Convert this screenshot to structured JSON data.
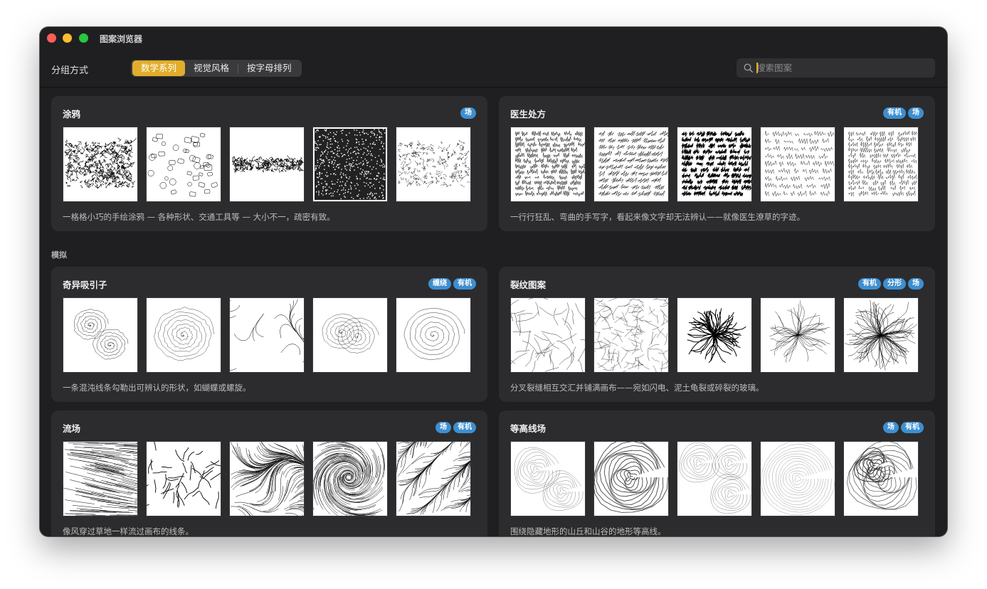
{
  "window": {
    "title": "图案浏览器"
  },
  "toolbar": {
    "group_label": "分组方式",
    "segments": [
      "数学系列",
      "视觉风格",
      "按字母排列"
    ],
    "active_segment": 0,
    "search": {
      "placeholder": "搜索图案",
      "value": ""
    }
  },
  "sections": [
    {
      "label": "",
      "cards": [
        {
          "title": "涂鸦",
          "tags": [
            "场"
          ],
          "description": "一格格小巧的手绘涂鸦 — 各种形状、交通工具等 — 大小不一，疏密有致。",
          "thumbnails": [
            "dense-scribble",
            "doodle-shapes",
            "scribble-band",
            "dense-noise",
            "sparse-scribble"
          ]
        },
        {
          "title": "医生处方",
          "tags": [
            "有机",
            "场"
          ],
          "description": "一行行狂乱、弯曲的手写字，看起来像文字却无法辨认——就像医生潦草的字迹。",
          "thumbnails": [
            "handwriting-rows",
            "slanted-scrawl",
            "dense-scrawl",
            "loose-writing",
            "cursive-rows"
          ]
        }
      ]
    },
    {
      "label": "模拟",
      "cards": [
        {
          "title": "奇异吸引子",
          "tags": [
            "缠绕",
            "有机"
          ],
          "description": "一条混沌线条勾勒出可辨认的形状，如蝴蝶或螺旋。",
          "thumbnails": [
            "lorenz-butterfly",
            "spiral-orbit",
            "tangled-loop",
            "double-spiral",
            "ring-attractor"
          ]
        },
        {
          "title": "裂纹图案",
          "tags": [
            "有机",
            "分形",
            "场"
          ],
          "description": "分叉裂缝相互交汇并铺满画布——宛如闪电、泥土龟裂或碎裂的玻璃。",
          "thumbnails": [
            "straight-cracks",
            "dense-cracks",
            "starburst",
            "radial-branches",
            "dense-branches"
          ]
        },
        {
          "title": "流场",
          "tags": [
            "场",
            "有机"
          ],
          "description": "像风穿过草地一样流过画布的线条。",
          "thumbnails": [
            "wind-lines",
            "branching-rivers",
            "flow-streams",
            "vortex-field",
            "diagonal-waves"
          ]
        },
        {
          "title": "等高线场",
          "tags": [
            "场",
            "有机"
          ],
          "description": "围绕隐藏地形的山丘和山谷的地形等高线。",
          "thumbnails": [
            "topo-contours",
            "bold-contours",
            "diagonal-contours",
            "ring-contours",
            "dark-terrain"
          ]
        }
      ]
    }
  ]
}
